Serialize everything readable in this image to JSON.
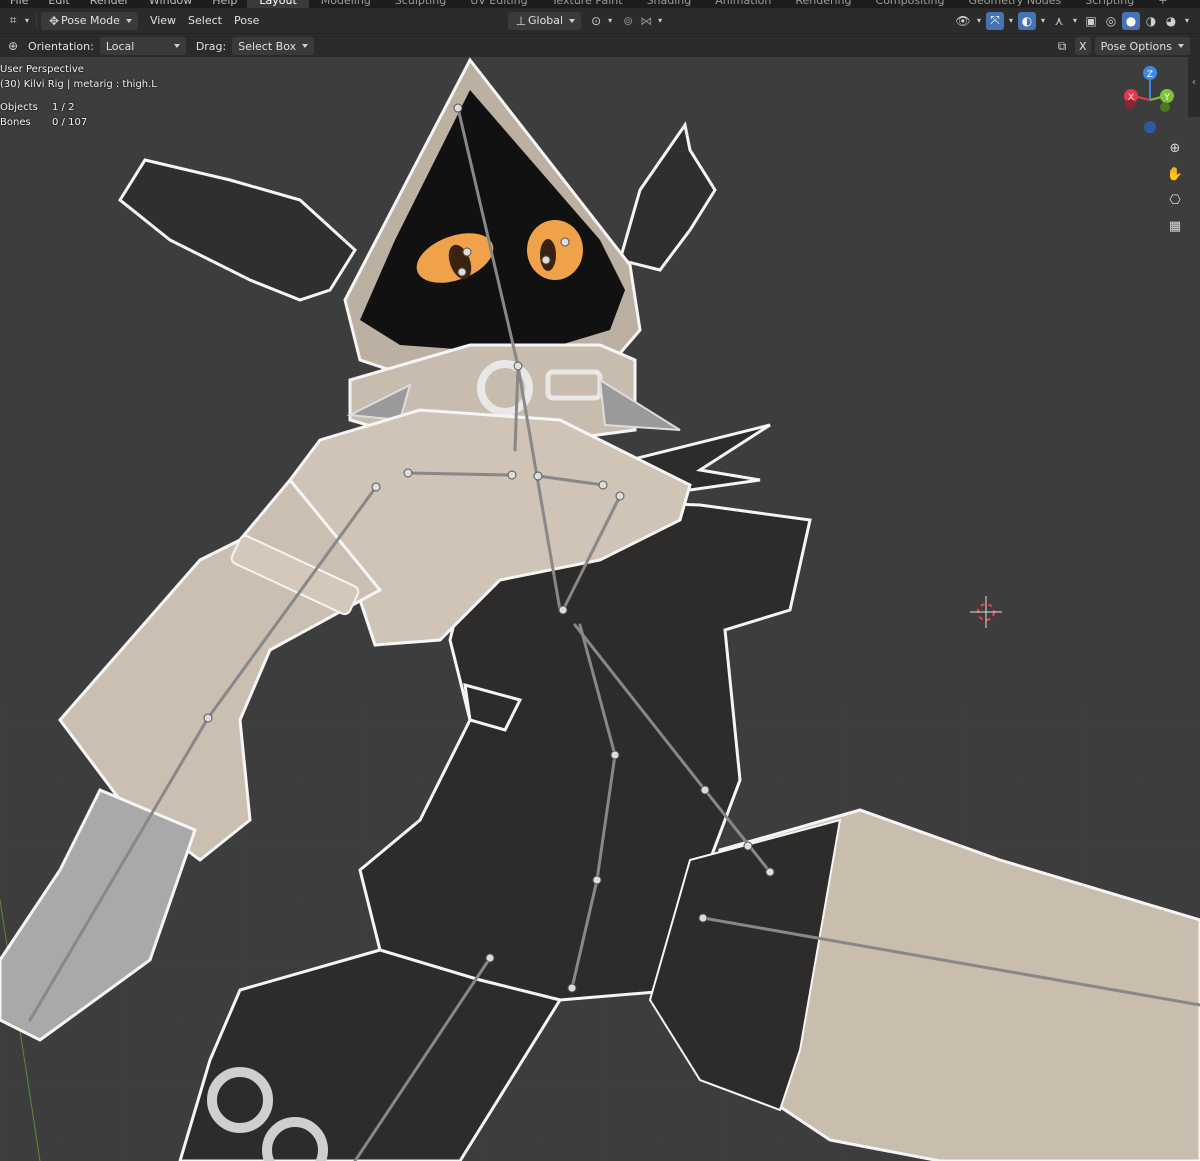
{
  "top_menu": {
    "items": [
      "File",
      "Edit",
      "Render",
      "Window",
      "Help"
    ],
    "workspaces": [
      "Layout",
      "Modeling",
      "Sculpting",
      "UV Editing",
      "Texture Paint",
      "Shading",
      "Animation",
      "Rendering",
      "Compositing",
      "Geometry Nodes",
      "Scripting",
      "+"
    ],
    "active_workspace": "Layout"
  },
  "header": {
    "mode": "Pose Mode",
    "menus": [
      "View",
      "Select",
      "Pose"
    ],
    "transform_orientation": "Global"
  },
  "tool_settings": {
    "orientation_label": "Orientation:",
    "orientation_value": "Local",
    "drag_label": "Drag:",
    "drag_value": "Select Box",
    "x_mirror": "X",
    "pose_options": "Pose Options"
  },
  "viewport_info": {
    "perspective": "User Perspective",
    "context": "(30) Kilvi Rig | metarig : thigh.L",
    "objects_label": "Objects",
    "objects_value": "1 / 2",
    "bones_label": "Bones",
    "bones_value": "0 / 107"
  },
  "gizmo": {
    "axes": [
      "Z",
      "Y",
      "X"
    ],
    "colors": {
      "x": "#e5394a",
      "y": "#7bc438",
      "z": "#3c8ae6"
    }
  },
  "nav_icons": [
    "zoom-icon",
    "hand-pan-icon",
    "camera-icon",
    "grid-ortho-icon"
  ],
  "colors": {
    "accent": "#4772b3",
    "background": "#3d3d3d",
    "header": "#2b2b2b"
  }
}
